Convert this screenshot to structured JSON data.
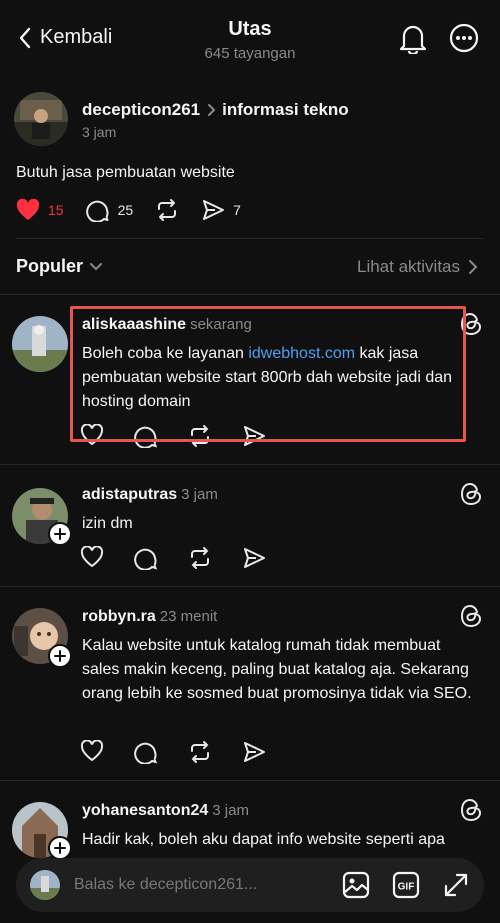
{
  "header": {
    "back_label": "Kembali",
    "title": "Utas",
    "views": "645 tayangan"
  },
  "post": {
    "author": "decepticon261",
    "topic": "informasi tekno",
    "time": "3 jam",
    "text": "Butuh jasa pembuatan website",
    "likes": "15",
    "comments": "25",
    "shares": "7"
  },
  "sort": {
    "label": "Populer",
    "activity_label": "Lihat aktivitas"
  },
  "replies": [
    {
      "username": "aliskaaashine",
      "time": "sekarang",
      "text_before": "Boleh coba ke layanan ",
      "link": "idwebhost.com",
      "text_after": " kak jasa pembuatan website start 800rb dah website jadi dan hosting domain"
    },
    {
      "username": "adistaputras",
      "time": "3 jam",
      "text": "izin dm"
    },
    {
      "username": "robbyn.ra",
      "time": "23 menit",
      "text": "Kalau website untuk katalog rumah tidak membuat sales makin keceng, paling buat katalog aja. Sekarang orang lebih ke sosmed buat promosinya tidak via SEO."
    },
    {
      "username": "yohanesanton24",
      "time": "3 jam",
      "text": "Hadir kak, boleh aku dapat info website seperti apa"
    }
  ],
  "composer": {
    "placeholder": "Balas ke decepticon261..."
  },
  "colors": {
    "background": "#101010",
    "like_red": "#ff3040",
    "link_blue": "#4fa0f0",
    "highlight_box": "#e5574b"
  },
  "icons": [
    "chevron-left-icon",
    "bell-icon",
    "more-icon",
    "heart-icon",
    "comment-icon",
    "repost-icon",
    "share-icon",
    "chevron-down-icon",
    "chevron-right-icon",
    "threads-icon",
    "plus-icon",
    "image-icon",
    "gif-icon",
    "expand-icon"
  ]
}
